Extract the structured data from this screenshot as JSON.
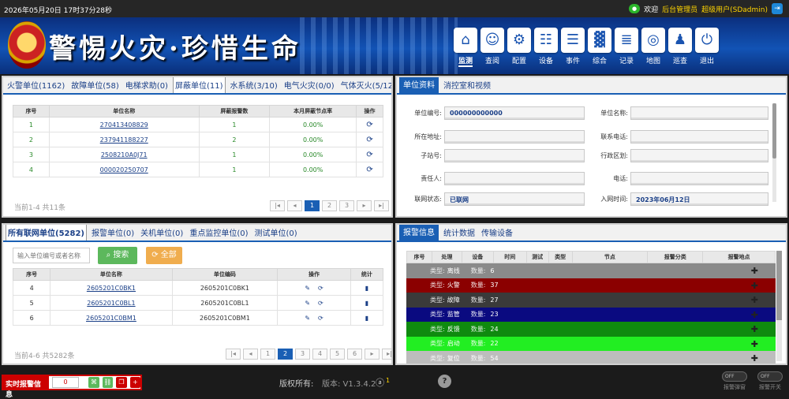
{
  "topbar": {
    "datetime": "2026年05月20日 17时37分28秒",
    "welcome": "欢迎",
    "role": "后台管理员",
    "user": "超级用户(SDadmin)"
  },
  "banner": {
    "slogan": "警惕火灾·珍惜生命"
  },
  "nav": [
    {
      "label": "监测",
      "icon": "monitor-icon",
      "glyph": "⌂",
      "active": true
    },
    {
      "label": "查阅",
      "icon": "person-icon",
      "glyph": "☺"
    },
    {
      "label": "配置",
      "icon": "gear-icon",
      "glyph": "⚙"
    },
    {
      "label": "设备",
      "icon": "network-icon",
      "glyph": "☷"
    },
    {
      "label": "事件",
      "icon": "events-icon",
      "glyph": "☰"
    },
    {
      "label": "综合",
      "icon": "bar-chart-icon",
      "glyph": "▓"
    },
    {
      "label": "记录",
      "icon": "records-icon",
      "glyph": "≣"
    },
    {
      "label": "地图",
      "icon": "globe-icon",
      "glyph": "◎"
    },
    {
      "label": "巡查",
      "icon": "patrol-icon",
      "glyph": "♟"
    },
    {
      "label": "退出",
      "icon": "power-icon",
      "glyph": "⏻"
    }
  ],
  "p1": {
    "tabs": [
      "火警单位(1162)",
      "故障单位(58)",
      "电梯求助(0)",
      "屏蔽单位(11)",
      "水系统(3/10)",
      "电气火灾(0/0)",
      "气体灭火(5/12)"
    ],
    "active": 3,
    "headers": [
      "序号",
      "单位名称",
      "屏蔽报警数",
      "本月屏蔽节点率",
      "操作"
    ],
    "rows": [
      [
        "1",
        "270413408829",
        "1",
        "0.00%"
      ],
      [
        "2",
        "237941188227",
        "2",
        "0.00%"
      ],
      [
        "3",
        "2508210A0J71",
        "1",
        "0.00%"
      ],
      [
        "4",
        "000020250707",
        "1",
        "0.00%"
      ]
    ],
    "info": "当前1-4 共11条",
    "pages": [
      "|◂",
      "◂",
      "1",
      "2",
      "3",
      "▸",
      "▸|"
    ]
  },
  "p2": {
    "tabs": [
      "单位资料",
      "消控室和视频"
    ],
    "left": [
      {
        "label": "单位编号:",
        "value": "000000000000"
      },
      {
        "label": "所在地址:",
        "value": ""
      },
      {
        "label": "子站号:",
        "value": ""
      },
      {
        "label": "责任人:",
        "value": ""
      },
      {
        "label": "联网状态:",
        "value": "已联网"
      }
    ],
    "right": [
      {
        "label": "单位名称:",
        "value": ""
      },
      {
        "label": "联系电话:",
        "value": ""
      },
      {
        "label": "行政区划:",
        "value": ""
      },
      {
        "label": "电话:",
        "value": ""
      },
      {
        "label": "入网时间:",
        "value": "2023年06月12日"
      }
    ]
  },
  "p3": {
    "tabs": [
      "所有联网单位(5282)",
      "报警单位(0)",
      "关机单位(0)",
      "重点监控单位(0)",
      "测试单位(0)"
    ],
    "search_placeholder": "输入单位编号或者名称",
    "search_label": "搜索",
    "all_label": "全部",
    "headers": [
      "序号",
      "单位名称",
      "单位编码",
      "操作",
      "统计"
    ],
    "rows": [
      [
        "4",
        "2605201C0BK1",
        "2605201C0BK1"
      ],
      [
        "5",
        "2605201C0BL1",
        "2605201C0BL1"
      ],
      [
        "6",
        "2605201C0BM1",
        "2605201C0BM1"
      ]
    ],
    "info": "当前4-6 共5282条",
    "pages": [
      "|◂",
      "◂",
      "1",
      "2",
      "3",
      "4",
      "5",
      "6",
      "▸",
      "▸|"
    ]
  },
  "p4": {
    "tabs": [
      "报警信息",
      "统计数据",
      "传输设备"
    ],
    "headers": [
      "序号",
      "处理",
      "设备",
      "时间",
      "测试",
      "类型",
      "节点",
      "报警分类",
      "报警地点"
    ],
    "type_label": "类型:",
    "count_label": "数量:",
    "rows": [
      {
        "type": "离线",
        "count": "6",
        "bg": "#8a8a8a",
        "fg": "#ffffff"
      },
      {
        "type": "火警",
        "count": "37",
        "bg": "#8b0000",
        "fg": "#ffffff"
      },
      {
        "type": "故障",
        "count": "27",
        "bg": "#3a3a3a",
        "fg": "#ffffff"
      },
      {
        "type": "监管",
        "count": "23",
        "bg": "#0a0a80",
        "fg": "#ffffff"
      },
      {
        "type": "反馈",
        "count": "24",
        "bg": "#0f8a0f",
        "fg": "#ffffff"
      },
      {
        "type": "启动",
        "count": "22",
        "bg": "#22ee22",
        "fg": "#ffffff"
      },
      {
        "type": "复位",
        "count": "54",
        "bg": "#bdbdbd",
        "fg": "#ffffff"
      }
    ]
  },
  "footer": {
    "rt_label": "实时报警信息",
    "rt_value": "0",
    "copyright": "版权所有:",
    "version": "版本: V1.3.4.2",
    "user_count": "1",
    "toggle1": "报警弹窗",
    "toggle2": "报警开关",
    "off": "OFF"
  }
}
